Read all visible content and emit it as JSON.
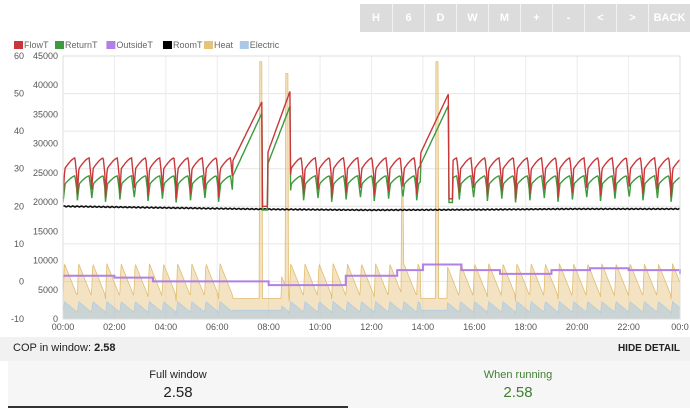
{
  "toolbar": {
    "buttons": [
      "H",
      "6",
      "D",
      "W",
      "M",
      "+",
      "-",
      "<",
      ">",
      "BACK"
    ]
  },
  "legend": [
    {
      "label": "FlowT",
      "color": "#c8383a"
    },
    {
      "label": "ReturnT",
      "color": "#3d9a3d"
    },
    {
      "label": "OutsideT",
      "color": "#b180e6"
    },
    {
      "label": "RoomT",
      "color": "#000000"
    },
    {
      "label": "Heat",
      "color": "#e7c277"
    },
    {
      "label": "Electric",
      "color": "#a9c9e6"
    }
  ],
  "chart_data": {
    "type": "line",
    "x_ticks": [
      "00:00",
      "02:00",
      "04:00",
      "06:00",
      "08:00",
      "10:00",
      "12:00",
      "14:00",
      "16:00",
      "18:00",
      "20:00",
      "22:00",
      "00:0"
    ],
    "y_left": {
      "ticks": [
        60,
        50,
        40,
        30,
        20,
        10,
        0,
        -10
      ],
      "ylim": [
        -10,
        60
      ]
    },
    "y_right": {
      "ticks": [
        45000,
        40000,
        35000,
        30000,
        25000,
        20000,
        15000,
        10000,
        5000,
        0
      ],
      "ylim": [
        0,
        45000
      ]
    },
    "series": [
      {
        "name": "FlowT",
        "axis": "left",
        "summary": "cycles 27–34, peaks ~50 at 07:40–08:40 and 14:00–15:10"
      },
      {
        "name": "ReturnT",
        "axis": "left",
        "summary": "cycles 24–29, peaks ~47"
      },
      {
        "name": "OutsideT",
        "axis": "left",
        "approx": [
          [
            0,
            1.5
          ],
          [
            2,
            1
          ],
          [
            3.5,
            0
          ],
          [
            8,
            -1
          ],
          [
            11,
            1.5
          ],
          [
            13,
            3
          ],
          [
            14,
            4.5
          ],
          [
            15.5,
            3
          ],
          [
            17,
            2
          ],
          [
            19,
            3
          ],
          [
            20.5,
            3.5
          ],
          [
            22,
            3
          ],
          [
            24,
            2
          ]
        ]
      },
      {
        "name": "RoomT",
        "axis": "left",
        "approx": [
          [
            0,
            20
          ],
          [
            4,
            19.6
          ],
          [
            8,
            19.2
          ],
          [
            12,
            19
          ],
          [
            16,
            19.1
          ],
          [
            20,
            19.3
          ],
          [
            24,
            19.3
          ]
        ]
      },
      {
        "name": "Heat",
        "axis": "right",
        "summary": "cycling 3000–10000 W, spikes to ~44000 W near 07:40, 08:40, 13:10, 14:30"
      },
      {
        "name": "Electric",
        "axis": "right",
        "summary": "cycling 500–3000 W"
      }
    ],
    "grid": true,
    "legend_position": "top-left"
  },
  "cop": {
    "label": "COP in window:",
    "value": "2.58"
  },
  "hide_detail": "HIDE DETAIL",
  "stats": {
    "full": {
      "title": "Full window",
      "value": "2.58"
    },
    "running": {
      "title": "When running",
      "value": "2.58"
    }
  }
}
